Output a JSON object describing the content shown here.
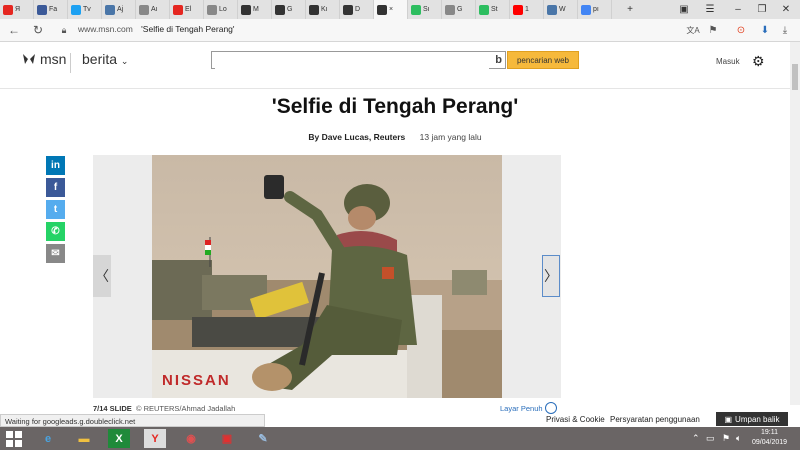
{
  "browser": {
    "tabs": [
      {
        "label": "Я",
        "icon": "yandex-icon",
        "color": "#e52620"
      },
      {
        "label": "Fa",
        "icon": "facebook-icon",
        "color": "#3b5998"
      },
      {
        "label": "Tv",
        "icon": "twitter-icon",
        "color": "#1da1f2"
      },
      {
        "label": "Aj",
        "icon": "vk-icon",
        "color": "#4a76a8"
      },
      {
        "label": "Aı",
        "icon": "page-icon",
        "color": "#888888"
      },
      {
        "label": "El",
        "icon": "yahoo-icon",
        "color": "#e52620"
      },
      {
        "label": "Lo",
        "icon": "page-icon",
        "color": "#888888"
      },
      {
        "label": "M",
        "icon": "msn-icon",
        "color": "#333333"
      },
      {
        "label": "G",
        "icon": "msn-icon",
        "color": "#333333"
      },
      {
        "label": "Kı",
        "icon": "msn-icon",
        "color": "#333333"
      },
      {
        "label": "D",
        "icon": "msn-icon",
        "color": "#333333"
      },
      {
        "label": "×",
        "icon": "msn-icon",
        "color": "#333333",
        "active": true
      },
      {
        "label": "Sı",
        "icon": "evernote-icon",
        "color": "#2dbe60"
      },
      {
        "label": "G",
        "icon": "page-icon",
        "color": "#888888"
      },
      {
        "label": "St",
        "icon": "evernote-icon",
        "color": "#2dbe60"
      },
      {
        "label": "1",
        "icon": "youtube-icon",
        "color": "#ff0000"
      },
      {
        "label": "W",
        "icon": "vk-icon",
        "color": "#4a76a8"
      },
      {
        "label": "pı",
        "icon": "google-icon",
        "color": "#4285f4"
      }
    ],
    "new_tab": "+",
    "url_domain": "www.msn.com",
    "url_title": "'Selfie di Tengah Perang'"
  },
  "header": {
    "logo": "msn",
    "section": "berita",
    "search_placeholder": "",
    "search_button": "pencarian web",
    "signin": "Masuk"
  },
  "article": {
    "title": "'Selfie di Tengah Perang'",
    "author": "By Dave Lucas, Reuters",
    "time": "13 jam yang lalu",
    "share_buttons": [
      {
        "name": "linkedin",
        "glyph": "in",
        "color": "#0077b5"
      },
      {
        "name": "facebook",
        "glyph": "f",
        "color": "#3b5998"
      },
      {
        "name": "twitter",
        "glyph": "t",
        "color": "#55acee"
      },
      {
        "name": "whatsapp",
        "glyph": "✆",
        "color": "#25d366"
      },
      {
        "name": "email",
        "glyph": "✉",
        "color": "#888888"
      }
    ],
    "slide_counter": "7/14 SLIDE",
    "credit": "© REUTERS/Ahmad Jadallah",
    "fullscreen": "Layar Penuh",
    "truck_text": "NISSAN"
  },
  "footer": {
    "status": "Waiting for googleads.g.doubleclick.net",
    "privacy": "Privasi & Cookie",
    "terms": "Persyaratan penggunaan",
    "feedback": "Umpan balik"
  },
  "taskbar": {
    "time": "19:11",
    "date": "09/04/2019"
  }
}
